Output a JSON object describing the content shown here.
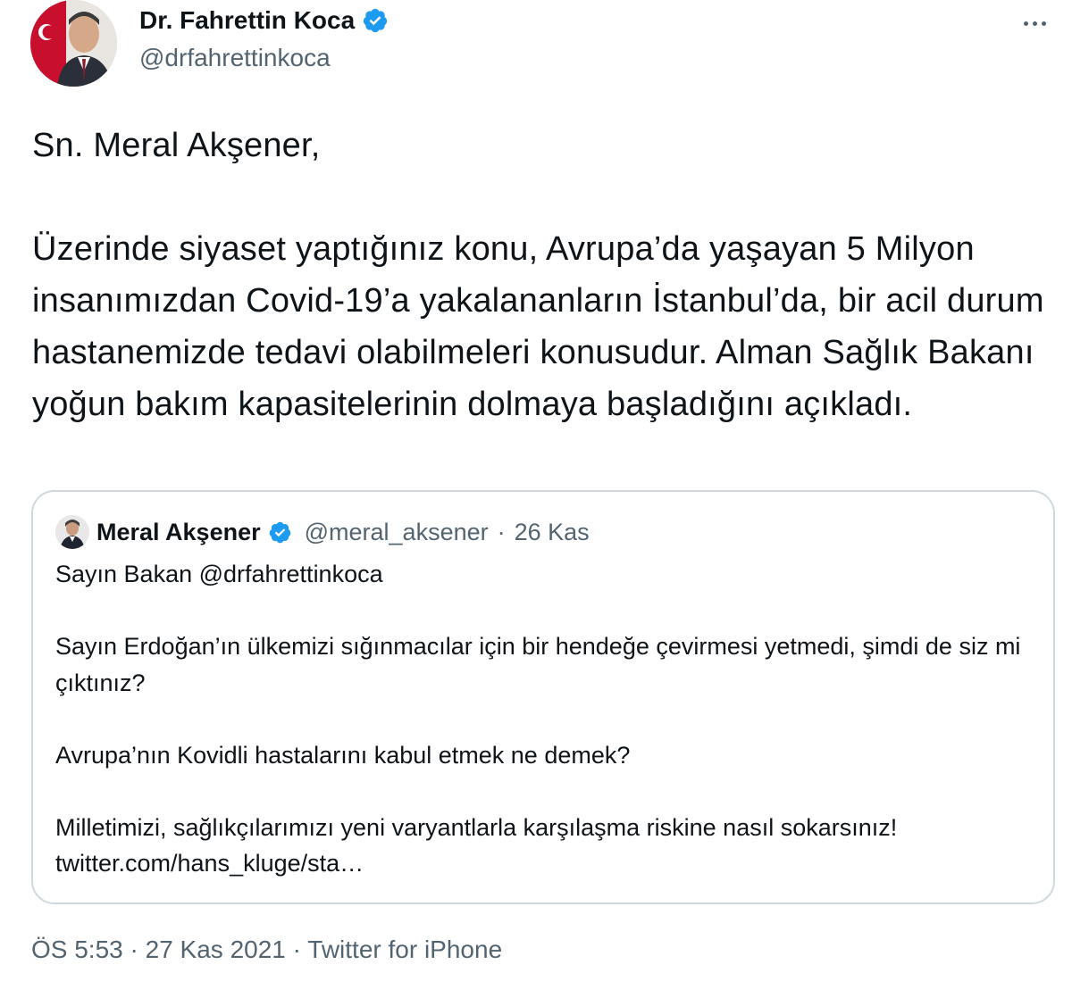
{
  "author": {
    "display_name": "Dr. Fahrettin Koca",
    "handle": "@drfahrettinkoca",
    "verified": true,
    "avatar_icon": "profile-photo-avatar"
  },
  "more_icon": "more-options-icon",
  "tweet": {
    "text": "Sn. Meral Akşener,\n\nÜzerinde siyaset yaptığınız konu, Avrupa’da yaşayan 5 Milyon insanımızdan Covid-19’a yakalananların İstanbul’da, bir acil durum hastanemizde tedavi olabilmeleri konusudur. Alman Sağlık Bakanı yoğun bakım kapasitelerinin dolmaya başladığını açıkladı."
  },
  "quoted_tweet": {
    "display_name": "Meral Akşener",
    "handle": "@meral_aksener",
    "date": "26 Kas",
    "verified": true,
    "text": "Sayın Bakan @drfahrettinkoca\n\nSayın Erdoğan’ın ülkemizi sığınmacılar için bir hendeğe çevirmesi yetmedi, şimdi de siz mi çıktınız?\n\nAvrupa’nın Kovidli hastalarını kabul etmek ne demek?\n\nMilletimizi, sağlıkçılarımızı yeni varyantlarla karşılaşma riskine nasıl sokarsınız!",
    "link": "twitter.com/hans_kluge/sta…"
  },
  "footer": {
    "time": "ÖS 5:53",
    "date": "27 Kas 2021",
    "source": "Twitter for iPhone",
    "separator": "·"
  },
  "colors": {
    "text_primary": "#0f1419",
    "text_secondary": "#536471",
    "verified_blue": "#1d9bf0",
    "border": "#cfd9de"
  }
}
